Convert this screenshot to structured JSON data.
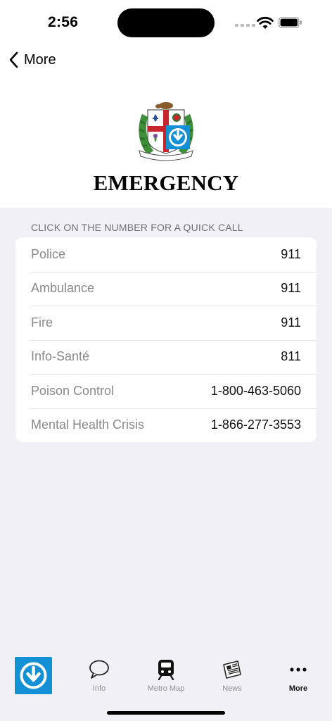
{
  "status_bar": {
    "time": "2:56"
  },
  "nav": {
    "back_label": "More"
  },
  "header": {
    "title": "EMERGENCY",
    "crest_motto": "CONCORDIA SALUS"
  },
  "section": {
    "header": "CLICK ON THE NUMBER FOR A QUICK CALL"
  },
  "contacts": [
    {
      "label": "Police",
      "number": "911"
    },
    {
      "label": "Ambulance",
      "number": "911"
    },
    {
      "label": "Fire",
      "number": "911"
    },
    {
      "label": "Info-Santé",
      "number": "811"
    },
    {
      "label": "Poison Control",
      "number": "1-800-463-5060"
    },
    {
      "label": "Mental Health Crisis",
      "number": "1-866-277-3553"
    }
  ],
  "tabs": [
    {
      "label": "Info",
      "icon": "speech-bubble-icon"
    },
    {
      "label": "Metro Map",
      "icon": "metro-train-icon"
    },
    {
      "label": "News",
      "icon": "newspaper-icon"
    },
    {
      "label": "More",
      "icon": "ellipsis-icon",
      "active": true
    }
  ],
  "colors": {
    "stm_blue": "#1490d6",
    "background": "#f1f0f6"
  }
}
